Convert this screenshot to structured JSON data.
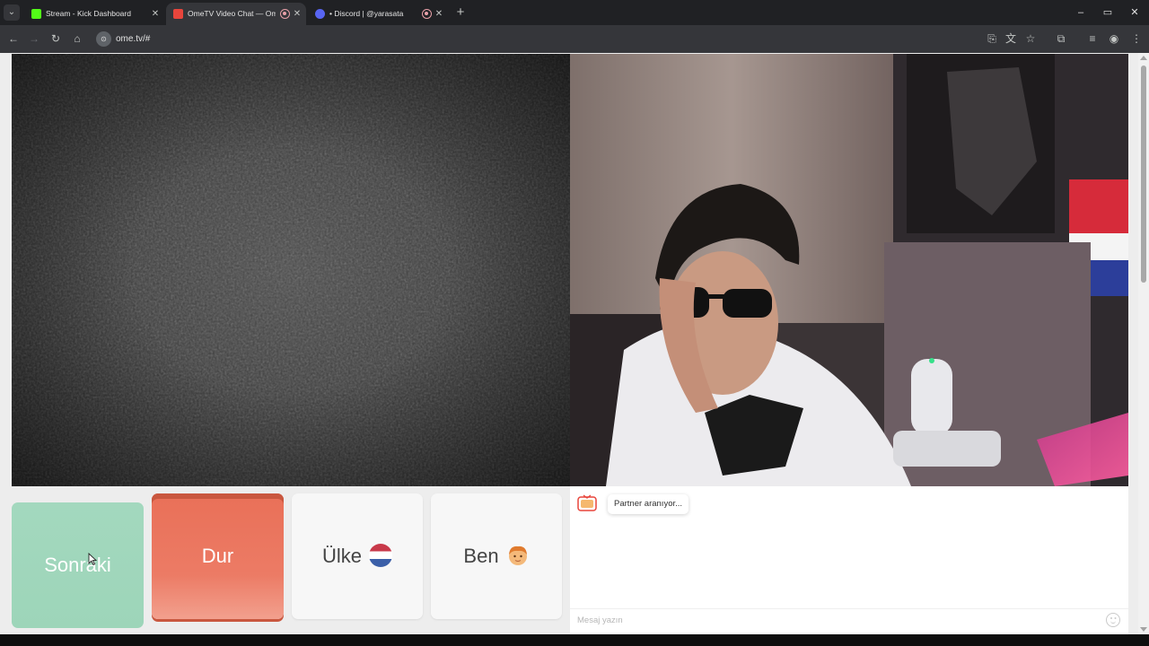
{
  "browser": {
    "tabs": [
      {
        "title": "Stream - Kick Dashboard",
        "active": false,
        "favicon": "kick-icon",
        "recording": false
      },
      {
        "title": "OmeTV Video Chat — Ome",
        "active": true,
        "favicon": "ometv-icon",
        "recording": true
      },
      {
        "title": "• Discord | @yarasata",
        "active": false,
        "favicon": "discord-icon",
        "recording": true
      }
    ],
    "url": "ome.tv/#",
    "new_tab": "+",
    "window_controls": {
      "minimize": "–",
      "maximize": "▭",
      "close": "✕"
    }
  },
  "controls": {
    "next_label": "Sonraki",
    "stop_label": "Dur",
    "country_label": "Ülke",
    "country_flag": "netherlands-flag-icon",
    "me_label": "Ben",
    "me_icon": "boy-emoji-icon"
  },
  "chat": {
    "status": "Partner aranıyor...",
    "input_placeholder": "Mesaj yazın"
  },
  "colors": {
    "next_button": "#9fd6bb",
    "stop_button": "#ea735c",
    "chat_background": "#ffffff"
  }
}
